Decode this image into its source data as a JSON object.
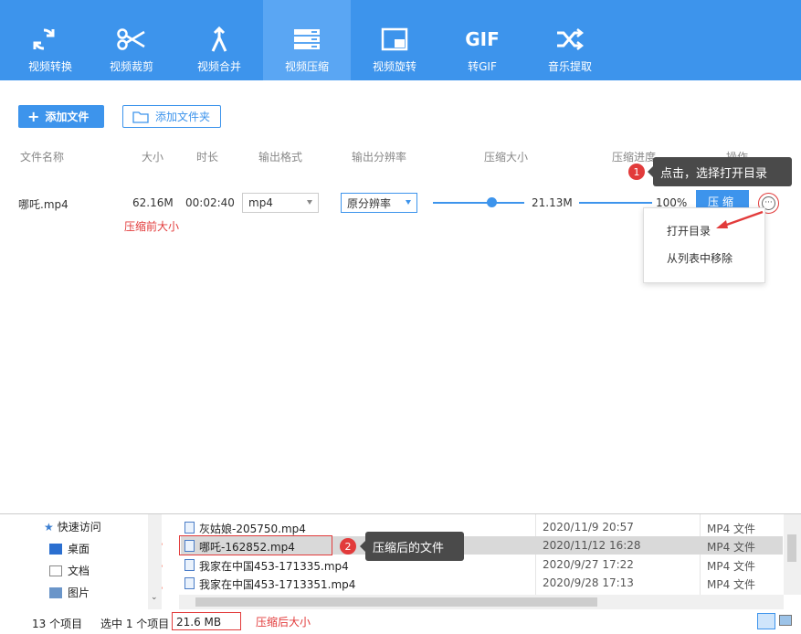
{
  "toolbar": {
    "items": [
      {
        "label": "视频转换",
        "icon": "refresh-icon"
      },
      {
        "label": "视频裁剪",
        "icon": "scissors-icon"
      },
      {
        "label": "视频合并",
        "icon": "merge-icon"
      },
      {
        "label": "视频压缩",
        "icon": "compress-icon",
        "active": true
      },
      {
        "label": "视频旋转",
        "icon": "rotate-icon"
      },
      {
        "label": "转GIF",
        "icon": "gif-icon"
      },
      {
        "label": "音乐提取",
        "icon": "shuffle-icon"
      }
    ],
    "gif_text": "GIF"
  },
  "actions": {
    "add_file": "添加文件",
    "add_folder": "添加文件夹"
  },
  "table": {
    "headers": [
      "文件名称",
      "大小",
      "时长",
      "输出格式",
      "输出分辨率",
      "压缩大小",
      "压缩进度",
      "操作"
    ],
    "row": {
      "name": "哪吒.mp4",
      "size": "62.16M",
      "duration": "00:02:40",
      "format": "mp4",
      "resolution": "原分辨率",
      "compression_level": 0.6,
      "compressed_size": "21.13M",
      "progress": "100%",
      "progress_value": 1.0,
      "compress_button": "压缩",
      "more_button": "···"
    }
  },
  "annotations": {
    "before_size": "压缩前大小",
    "step1_badge": "1",
    "step1_text": "点击，选择打开目录",
    "step2_badge": "2",
    "step2_text": "压缩后的文件",
    "after_size": "压缩后大小"
  },
  "context_menu": {
    "open_dir": "打开目录",
    "remove": "从列表中移除"
  },
  "explorer": {
    "nav": [
      {
        "label": "快速访问"
      },
      {
        "label": "桌面"
      },
      {
        "label": "文档"
      },
      {
        "label": "图片"
      }
    ],
    "files": [
      {
        "name": "灰姑娘-205750.mp4",
        "date": "2020/11/9 20:57",
        "type": "MP4 文件"
      },
      {
        "name": "哪吒-162852.mp4",
        "date": "2020/11/12 16:28",
        "type": "MP4 文件",
        "selected": true
      },
      {
        "name": "我家在中国453-171335.mp4",
        "date": "2020/9/27 17:22",
        "type": "MP4 文件"
      },
      {
        "name": "我家在中国453-1713351.mp4",
        "date": "2020/9/28 17:13",
        "type": "MP4 文件"
      }
    ],
    "status": {
      "count": "13 个项目",
      "selected": "选中 1 个项目",
      "size": "21.6 MB"
    }
  },
  "colors": {
    "accent": "#3d94ec",
    "annotation_red": "#e23b3b",
    "tooltip_bg": "#4a4a4a"
  }
}
